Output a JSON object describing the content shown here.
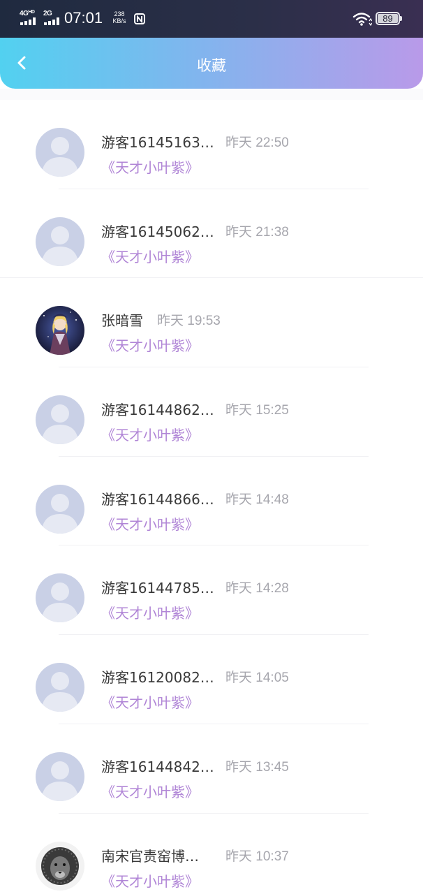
{
  "status_bar": {
    "network_1": "4G",
    "network_1_hd": "HD",
    "network_2": "2G",
    "time": "07:01",
    "speed_value": "238",
    "speed_unit": "KB/s",
    "battery_level": "89"
  },
  "header": {
    "title": "收藏",
    "back_icon": "chevron-left-icon"
  },
  "favorites": [
    {
      "name": "游客16145163…",
      "time": "昨天 22:50",
      "book": "《天才小叶紫》",
      "avatar": "default-avatar"
    },
    {
      "name": "游客16145062…",
      "time": "昨天 21:38",
      "book": "《天才小叶紫》",
      "avatar": "default-avatar"
    },
    {
      "name": "张暗雪",
      "time": "昨天 19:53",
      "book": "《天才小叶紫》",
      "avatar": "anime-girl-avatar"
    },
    {
      "name": "游客16144862…",
      "time": "昨天 15:25",
      "book": "《天才小叶紫》",
      "avatar": "default-avatar"
    },
    {
      "name": "游客16144866…",
      "time": "昨天 14:48",
      "book": "《天才小叶紫》",
      "avatar": "default-avatar"
    },
    {
      "name": "游客16144785…",
      "time": "昨天 14:28",
      "book": "《天才小叶紫》",
      "avatar": "default-avatar"
    },
    {
      "name": "游客16120082…",
      "time": "昨天 14:05",
      "book": "《天才小叶紫》",
      "avatar": "default-avatar"
    },
    {
      "name": "游客16144842…",
      "time": "昨天 13:45",
      "book": "《天才小叶紫》",
      "avatar": "default-avatar"
    },
    {
      "name": "南宋官责窑博…",
      "time": "昨天 10:37",
      "book": "《天才小叶紫》",
      "avatar": "lion-avatar"
    }
  ],
  "colors": {
    "header_start": "#52d1f0",
    "header_end": "#b99ae9",
    "book_title": "#b085d6",
    "timestamp": "#a6a6ad",
    "avatar_placeholder": "#c9d0e6"
  }
}
